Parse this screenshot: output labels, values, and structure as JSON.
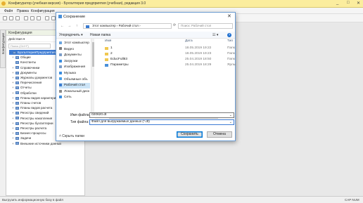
{
  "window": {
    "title": "Конфигуратор (учебная версия) - Бухгалтерия предприятия (учебная), редакция 3.0",
    "title_controls": [
      "_",
      "□",
      "✕"
    ]
  },
  "menubar": [
    "Файл",
    "Правка",
    "Конфигурация"
  ],
  "left_panel": {
    "side_tab": "Конфигурация",
    "header": "Конфигурация",
    "actions_label": "Действия ▾",
    "search_placeholder": "Поиск (Ctrl+F)",
    "tree": [
      {
        "label": "БухгалтерияПредприятияУчебная",
        "expander": "−",
        "selected": true
      },
      {
        "label": "Общие",
        "expander": "+"
      },
      {
        "label": "Константы",
        "expander": ""
      },
      {
        "label": "Справочники",
        "expander": "+"
      },
      {
        "label": "Документы",
        "expander": "+"
      },
      {
        "label": "Журналы документов",
        "expander": "+"
      },
      {
        "label": "Перечисления",
        "expander": "+"
      },
      {
        "label": "Отчеты",
        "expander": "+"
      },
      {
        "label": "Обработки",
        "expander": "+"
      },
      {
        "label": "Планы видов характеристик",
        "expander": "+"
      },
      {
        "label": "Планы счетов",
        "expander": "+"
      },
      {
        "label": "Планы видов расчета",
        "expander": "+"
      },
      {
        "label": "Регистры сведений",
        "expander": "+"
      },
      {
        "label": "Регистры накопления",
        "expander": "+"
      },
      {
        "label": "Регистры бухгалтерии",
        "expander": "+"
      },
      {
        "label": "Регистры расчета",
        "expander": "+"
      },
      {
        "label": "Бизнес-процессы",
        "expander": "+"
      },
      {
        "label": "Задачи",
        "expander": "+"
      },
      {
        "label": "Внешние источники данных",
        "expander": "+"
      }
    ]
  },
  "statusbar": {
    "left": "Выгрузить информационную базу в файл",
    "right": "CAP   NUM"
  },
  "dialog": {
    "title": "Сохранение",
    "close": "✕",
    "address": "Этот компьютер › Рабочий стол ›",
    "search_placeholder": "Поиск: Рабочий стол",
    "nav_buttons": [
      "←",
      "→",
      "↑",
      "⟳"
    ],
    "organize": "Упорядочить ▾",
    "new_folder": "Новая папка",
    "view_icons": "☷ ▾",
    "help_icon": "?",
    "nav_items": [
      {
        "label": "Этот компьютер",
        "color": "#6aa5e0"
      },
      {
        "label": "Видео",
        "color": "#7a7a7a"
      },
      {
        "label": "Документы",
        "color": "#7a9cc8"
      },
      {
        "label": "Загрузки",
        "color": "#3a8de0"
      },
      {
        "label": "Изображения",
        "color": "#7a9cc8"
      },
      {
        "label": "Музыка",
        "color": "#3a8de0"
      },
      {
        "label": "Объемные объ",
        "color": "#4aa0e8"
      },
      {
        "label": "Рабочий стол",
        "color": "#3a7bd0",
        "selected": true
      },
      {
        "label": "Локальный диск",
        "color": "#8a8a8a"
      },
      {
        "label": "Сеть",
        "color": "#3a8de0"
      }
    ],
    "columns": {
      "name": "Имя",
      "date": "Дата",
      "type": "Тип"
    },
    "files": [
      {
        "name": "1",
        "date": "18.05.2019 19:22",
        "type": "Папк",
        "icon_color": "#f0c850"
      },
      {
        "name": "2",
        "date": "18.05.2019 19:23",
        "type": "Папк",
        "icon_color": "#f0c850"
      },
      {
        "name": "EducFull83",
        "date": "25.04.2019 18:50",
        "type": "Папк",
        "icon_color": "#f0c850"
      },
      {
        "name": "Параметры",
        "date": "25.04.2019 18:29",
        "type": "Ярлы",
        "icon_color": "#4a90d9"
      }
    ],
    "filename_label": "Имя файла:",
    "filename_value": "020620.dt",
    "filetype_label": "Тип файла:",
    "filetype_value": "Файл для выгружаемых данных (*.dt)",
    "hide_folders": "˄  Скрыть папки",
    "save_button": "Сохранить",
    "cancel_button": "Отмена"
  }
}
